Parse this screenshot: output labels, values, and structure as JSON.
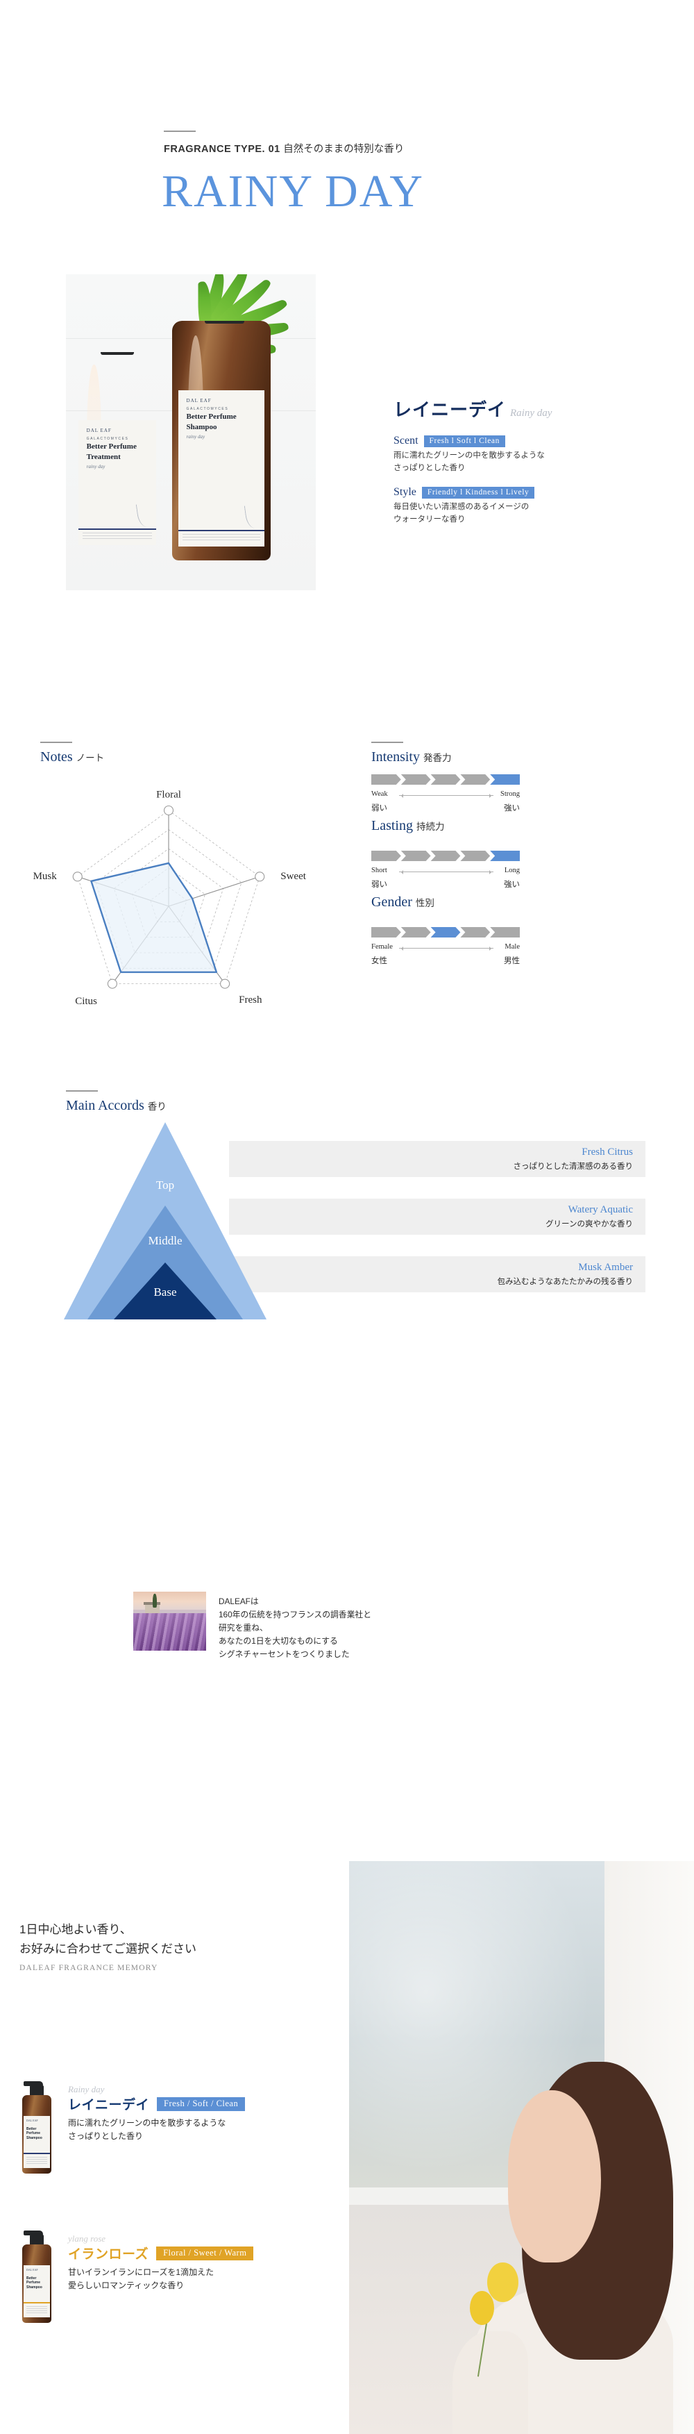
{
  "hero": {
    "kicker_en": "FRAGRANCE TYPE. 01",
    "kicker_jp": "自然そのままの特別な香り",
    "title": "RAINY DAY"
  },
  "product": {
    "name_jp": "レイニーデイ",
    "name_en": "Rainy day",
    "attributes": [
      {
        "label": "Scent",
        "tags": "Fresh  l  Soft  l  Clean",
        "desc_line1": "雨に濡れたグリーンの中を散歩するような",
        "desc_line2": "さっぱりとした香り"
      },
      {
        "label": "Style",
        "tags": "Friendly  l  Kindness  l  Lively",
        "desc_line1": "毎日使いたい清潔感のあるイメージの",
        "desc_line2": "ウォータリーな香り"
      }
    ],
    "bottles": [
      {
        "brand": "DAL EAF",
        "eyebrow": "GALACTOMYCES",
        "name_line1": "Better Perfume",
        "name_line2": "Treatment",
        "script": "rainy day"
      },
      {
        "brand": "DAL EAF",
        "eyebrow": "GALACTOMYCES",
        "name_line1": "Better Perfume",
        "name_line2": "Shampoo",
        "script": "rainy day"
      }
    ]
  },
  "notes_section": {
    "title_en": "Notes",
    "title_jp": "ノート"
  },
  "meters": [
    {
      "title_en": "Intensity",
      "title_jp": "発香力",
      "left_en": "Weak",
      "right_en": "Strong",
      "left_jp": "弱い",
      "right_jp": "強い",
      "segments": 5,
      "active_index": 5
    },
    {
      "title_en": "Lasting",
      "title_jp": "持続力",
      "left_en": "Short",
      "right_en": "Long",
      "left_jp": "弱い",
      "right_jp": "強い",
      "segments": 5,
      "active_index": 5
    },
    {
      "title_en": "Gender",
      "title_jp": "性別",
      "left_en": "Female",
      "right_en": "Male",
      "left_jp": "女性",
      "right_jp": "男性",
      "segments": 5,
      "active_index": 3
    }
  ],
  "accords_section": {
    "title_en": "Main Accords",
    "title_jp": "香り",
    "pyramid": [
      {
        "level": "Top",
        "color": "#9dc0ea"
      },
      {
        "level": "Middle",
        "color": "#6d9bd4"
      },
      {
        "level": "Base",
        "color": "#0d3572"
      }
    ],
    "rows": [
      {
        "en": "Fresh Citrus",
        "jp": "さっぱりとした清潔感のある香り"
      },
      {
        "en": "Watery Aquatic",
        "jp": "グリーンの爽やかな香り"
      },
      {
        "en": "Musk Amber",
        "jp": "包み込むようなあたたかみの残る香り"
      }
    ]
  },
  "brand_block": {
    "line1": "DALEAFは",
    "line2": "160年の伝統を持つフランスの調香業社と",
    "line3": "研究を重ね、",
    "line4": "あなたの1日を大切なものにする",
    "line5": "シグネチャーセントをつくりました"
  },
  "selector": {
    "headline_line1": "1日中心地よい香り、",
    "headline_line2": "お好みに合わせてご選択ください",
    "subhead": "DALEAF FRAGRANCE MEMORY",
    "items": [
      {
        "script": "Rainy day",
        "name": "レイニーデイ",
        "chip": "Fresh  /  Soft  /  Clean",
        "desc_line1": "雨に濡れたグリーンの中を散歩するような",
        "desc_line2": "さっぱりとした香り",
        "accent": "#5b8fd4",
        "bottle": {
          "brand": "DAL EAF",
          "name_line1": "Better Perfume",
          "name_line2": "Shampoo"
        }
      },
      {
        "script": "ylang rose",
        "name": "イランローズ",
        "chip": "Floral  /  Sweet  /  Warm",
        "desc_line1": "甘いイランイランにローズを1滴加えた",
        "desc_line2": "愛らしいロマンティックな香り",
        "accent": "#e0a326",
        "bottle": {
          "brand": "DAL EAF",
          "name_line1": "Better Perfume",
          "name_line2": "Shampoo"
        }
      }
    ]
  },
  "colors": {
    "hero_blue": "#5b94dd",
    "deep_navy": "#152e5e",
    "accent_blue": "#5b8fd4",
    "meter_grey": "#a9a9a9",
    "gold": "#e0a326"
  },
  "chart_data": {
    "type": "radar",
    "title": "Notes",
    "categories": [
      "Floral",
      "Sweet",
      "Fresh",
      "Citus",
      "Musk"
    ],
    "values": [
      0.45,
      0.26,
      0.85,
      0.85,
      0.85
    ],
    "rmax": 1.0,
    "rings": 5,
    "series": [
      {
        "name": "Rainy day",
        "values": [
          0.45,
          0.26,
          0.85,
          0.85,
          0.85
        ]
      }
    ],
    "line_color": "#4a7fc1",
    "fill_color": "#e8f1fa",
    "grid": "dashed",
    "legend": "none"
  }
}
